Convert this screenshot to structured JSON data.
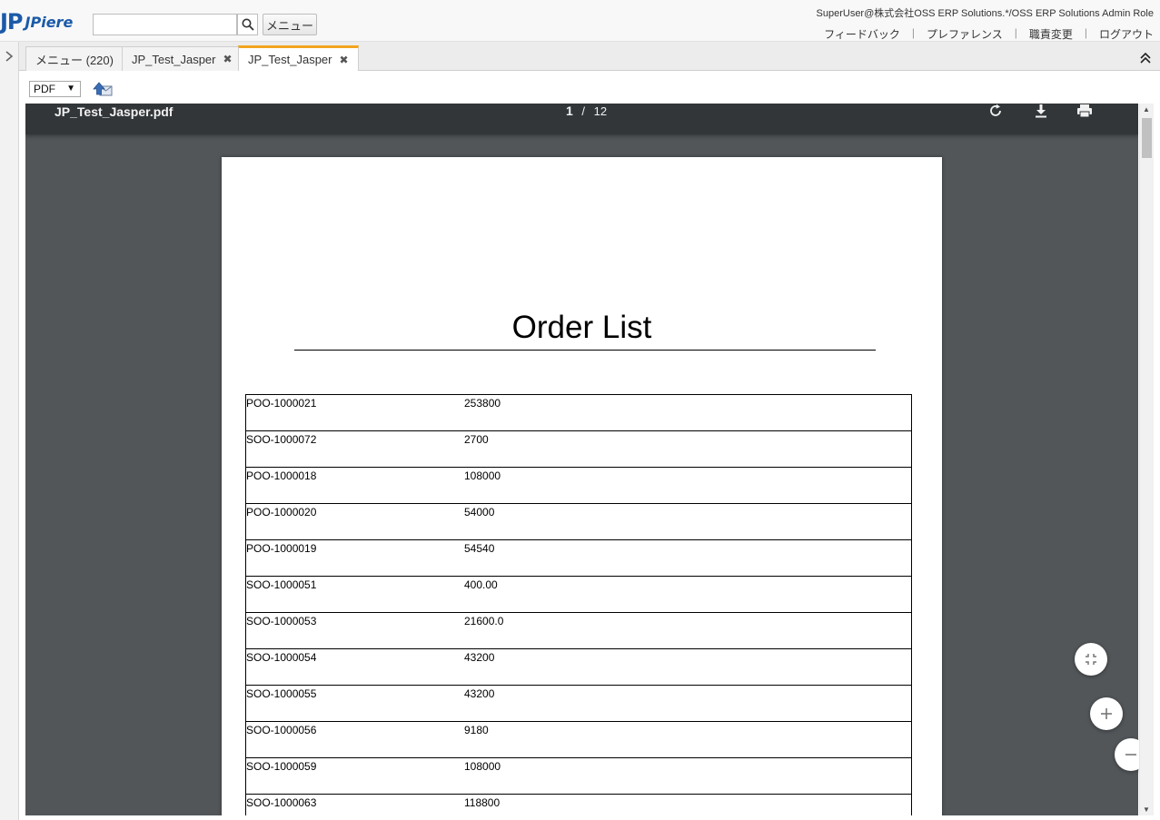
{
  "header": {
    "logo_mark": "JP",
    "logo_text": "JPiere",
    "search_placeholder": "",
    "menu_button": "メニュー",
    "user_info": "SuperUser@株式会社OSS ERP Solutions.*/OSS ERP Solutions Admin Role",
    "links": [
      "フィードバック",
      "プレファレンス",
      "職責変更",
      "ログアウト"
    ]
  },
  "tabs": [
    {
      "label": "メニュー (220)",
      "closable": false
    },
    {
      "label": "JP_Test_Jasper",
      "closable": true
    },
    {
      "label": "JP_Test_Jasper",
      "closable": true,
      "active": true
    }
  ],
  "tab_close_glyph": "✖",
  "toolbar": {
    "format_value": "PDF",
    "format_arrow": "▼"
  },
  "viewer": {
    "file_name": "JP_Test_Jasper.pdf",
    "page_current": "1",
    "page_separator": "/",
    "page_total": "12"
  },
  "document": {
    "title": "Order List",
    "rows": [
      {
        "doc_no": "POO-1000021",
        "amount": "253800"
      },
      {
        "doc_no": "SOO-1000072",
        "amount": "2700"
      },
      {
        "doc_no": "POO-1000018",
        "amount": "108000"
      },
      {
        "doc_no": "POO-1000020",
        "amount": "54000"
      },
      {
        "doc_no": "POO-1000019",
        "amount": "54540"
      },
      {
        "doc_no": "SOO-1000051",
        "amount": "400.00"
      },
      {
        "doc_no": "SOO-1000053",
        "amount": "21600.0"
      },
      {
        "doc_no": "SOO-1000054",
        "amount": "43200"
      },
      {
        "doc_no": "SOO-1000055",
        "amount": "43200"
      },
      {
        "doc_no": "SOO-1000056",
        "amount": "9180"
      },
      {
        "doc_no": "SOO-1000059",
        "amount": "108000"
      },
      {
        "doc_no": "SOO-1000063",
        "amount": "118800"
      }
    ]
  },
  "colors": {
    "brand": "#1a5aa8",
    "active_tab_accent": "#f2a51d",
    "viewer_bg": "#525659",
    "viewer_bar": "#323639"
  }
}
